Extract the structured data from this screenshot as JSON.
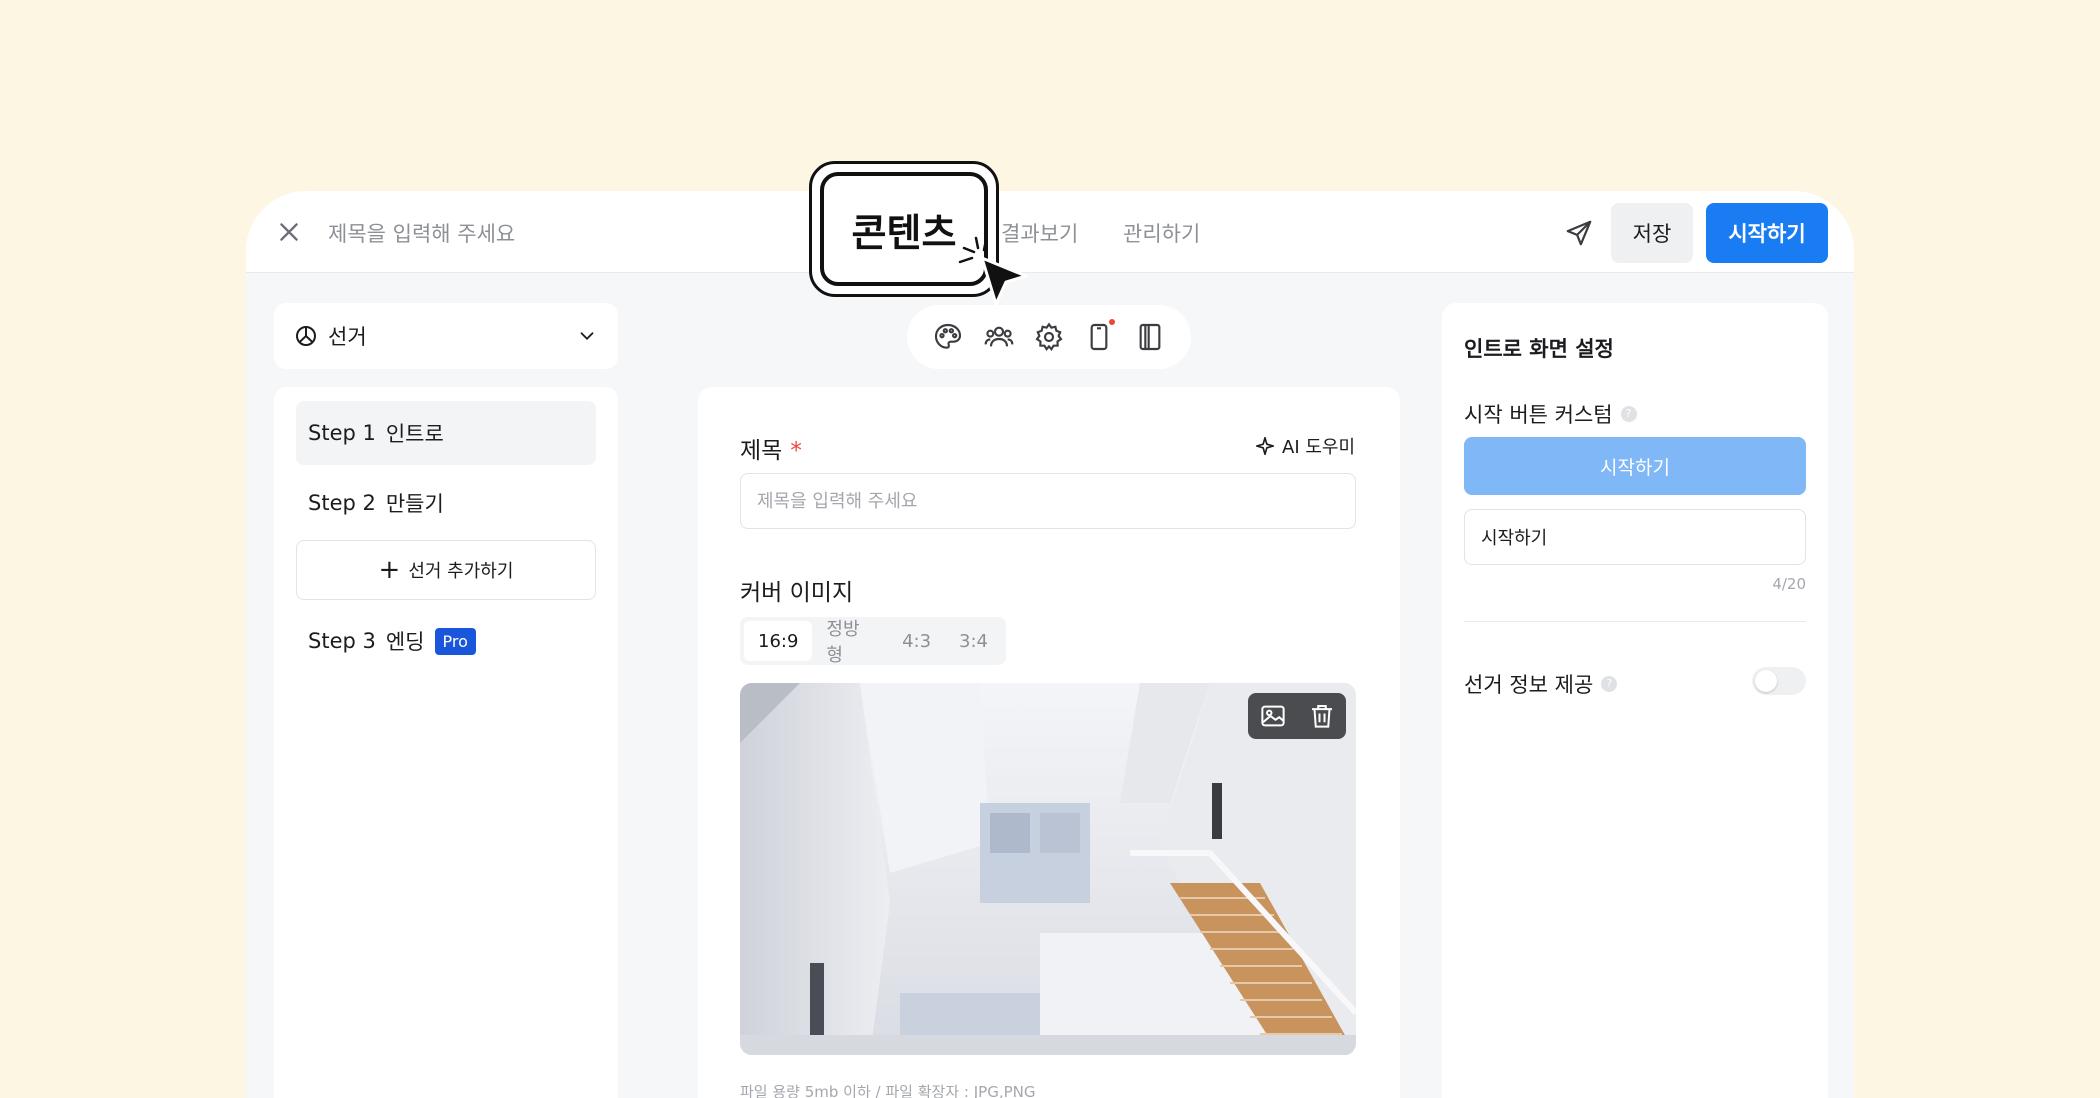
{
  "header": {
    "title_placeholder": "제목을 입력해 주세요",
    "tabs": [
      {
        "label": "콘텐츠"
      },
      {
        "label": "결과보기"
      },
      {
        "label": "관리하기"
      }
    ],
    "save_label": "저장",
    "start_label": "시작하기"
  },
  "sidebar": {
    "selector_label": "선거",
    "steps": [
      {
        "num": "Step 1",
        "label": "인트로"
      },
      {
        "num": "Step 2",
        "label": "만들기"
      },
      {
        "num": "Step 3",
        "label": "엔딩"
      }
    ],
    "add_label": "선거 추가하기",
    "pro_badge": "Pro"
  },
  "content": {
    "title_label": "제목",
    "required_mark": "*",
    "ai_helper_label": "AI 도우미",
    "title_placeholder": "제목을 입력해 주세요",
    "cover_label": "커버 이미지",
    "ratios": [
      "16:9",
      "정방형",
      "4:3",
      "3:4"
    ],
    "selected_ratio": "16:9",
    "file_hint": "파일 용량 5mb 이하 / 파일 확장자 : JPG,PNG"
  },
  "settings": {
    "title": "인트로 화면 설정",
    "button_custom_label": "시작 버튼 커스텀",
    "help_glyph": "?",
    "preview_button_label": "시작하기",
    "button_text_value": "시작하기",
    "char_count": "4/20",
    "elect_info_label": "선거 정보 제공",
    "elect_info_enabled": false
  },
  "colors": {
    "primary": "#1a7cf2",
    "preview_button": "#7fb7f7",
    "background": "#fdf6e2",
    "required": "#f0443a",
    "pro_badge": "#1a56db"
  }
}
